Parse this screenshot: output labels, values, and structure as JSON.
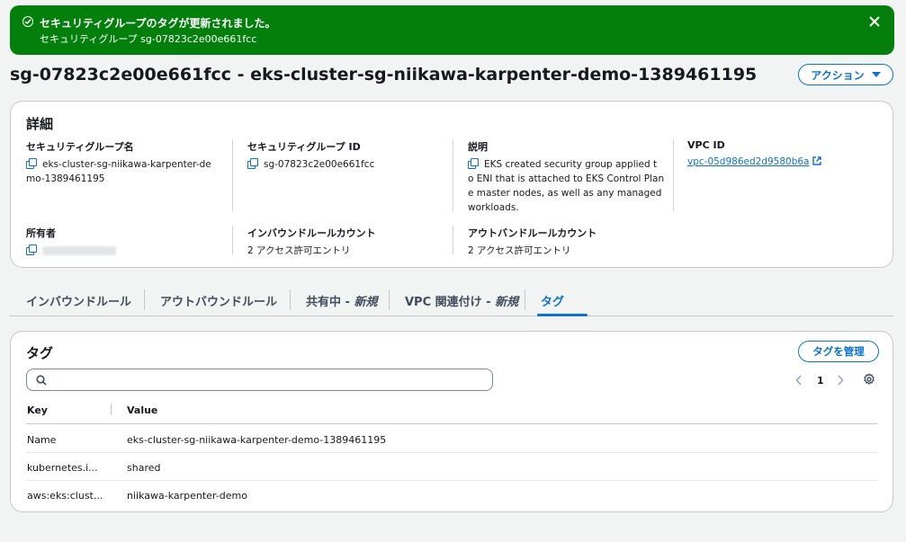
{
  "flash": {
    "title": "セキュリティグループのタグが更新されました。",
    "subtitle": "セキュリティグループ sg-07823c2e00e661fcc"
  },
  "header": {
    "title": "sg-07823c2e00e661fcc - eks-cluster-sg-niikawa-karpenter-demo-1389461195",
    "actions_label": "アクション"
  },
  "details": {
    "heading": "詳細",
    "sg_name_label": "セキュリティグループ名",
    "sg_name_line1": "eks-cluster-sg-niikawa-karpenter-de",
    "sg_name_line2": "mo-1389461195",
    "sg_id_label": "セキュリティグループ ID",
    "sg_id_value": "sg-07823c2e00e661fcc",
    "description_label": "説明",
    "description_line1": "EKS created security group applied t",
    "description_line2": "o ENI that is attached to EKS Control Plan",
    "description_line3": "e master nodes, as well as any managed",
    "description_line4": "workloads.",
    "vpc_label": "VPC ID",
    "vpc_value": "vpc-05d986ed2d9580b6a",
    "owner_label": "所有者",
    "inbound_label": "インバウンドルールカウント",
    "inbound_value": "2 アクセス許可エントリ",
    "outbound_label": "アウトバンドルールカウント",
    "outbound_value": "2 アクセス許可エントリ"
  },
  "tabs": [
    {
      "label": "インバウンドルール"
    },
    {
      "label": "アウトバウンドルール"
    },
    {
      "label": "共有中 - ",
      "tag": "新規"
    },
    {
      "label": "VPC 関連付け - ",
      "tag": "新規"
    },
    {
      "label": "タグ"
    }
  ],
  "tags": {
    "heading": "タグ",
    "manage_label": "タグを管理",
    "search_placeholder": "",
    "page": "1",
    "col_key": "Key",
    "col_value": "Value",
    "rows": [
      {
        "key": "Name",
        "value": "eks-cluster-sg-niikawa-karpenter-demo-1389461195"
      },
      {
        "key": "kubernetes.i...",
        "value": "shared"
      },
      {
        "key": "aws:eks:clust...",
        "value": "niikawa-karpenter-demo"
      }
    ]
  },
  "colors": {
    "success": "#037f0c",
    "accent": "#0972d3"
  }
}
